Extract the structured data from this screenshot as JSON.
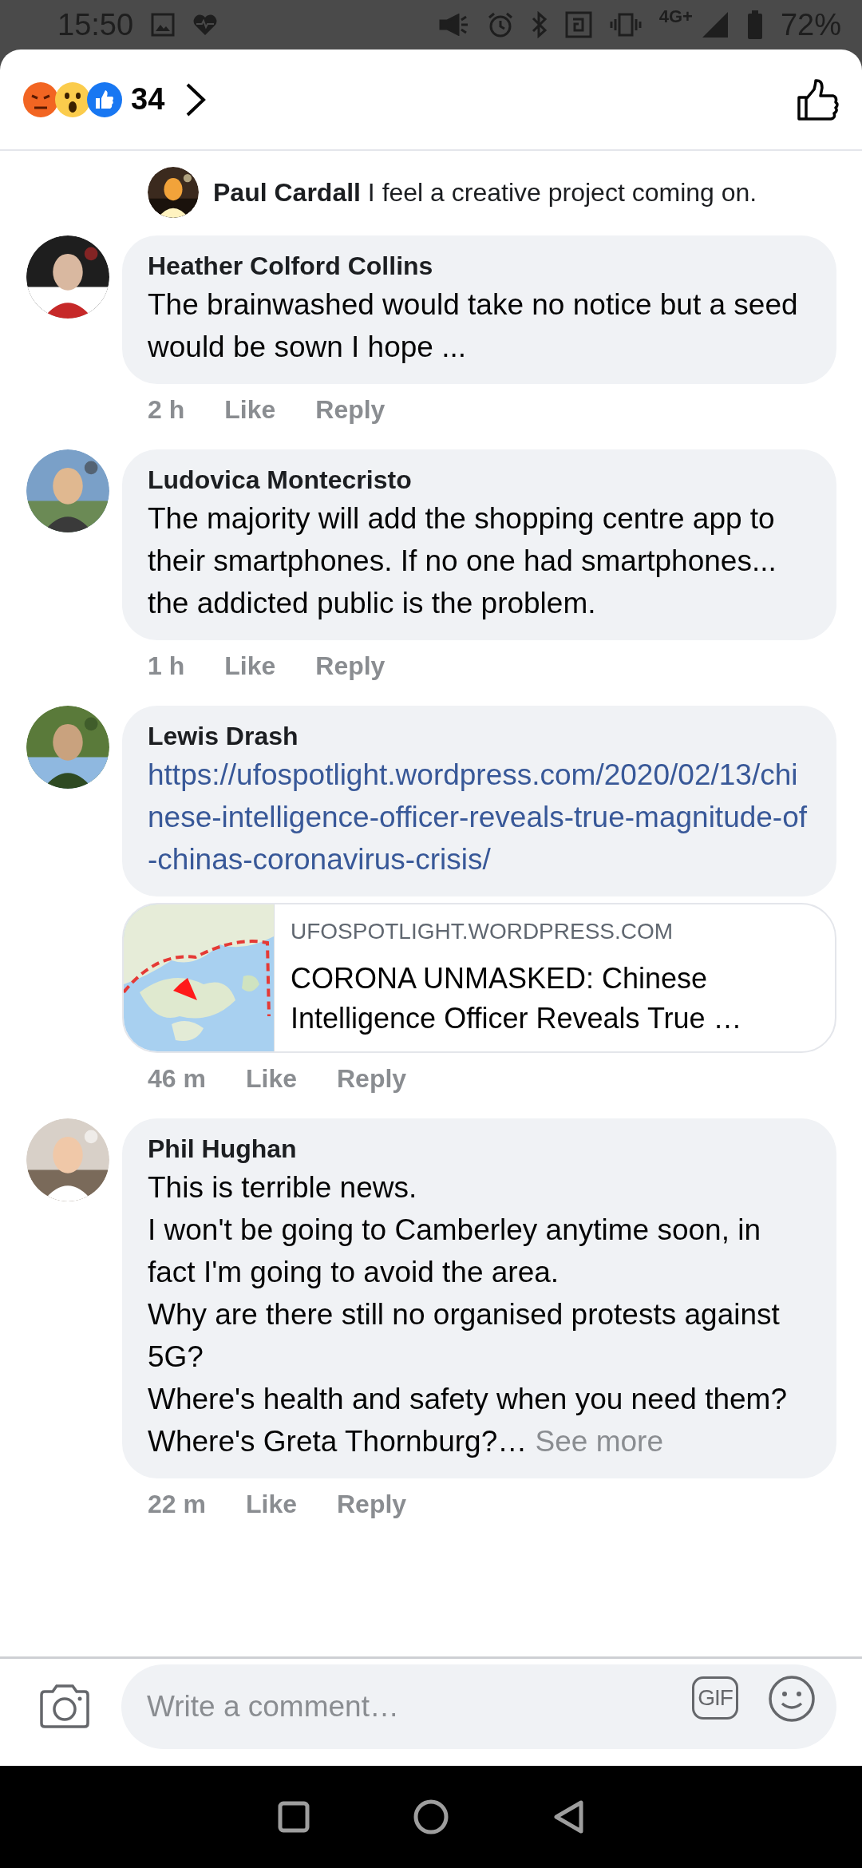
{
  "status_bar": {
    "time": "15:50",
    "network": "4G+",
    "battery": "72%"
  },
  "header": {
    "reaction_count": "34"
  },
  "reply_preview": {
    "author": "Paul Cardall",
    "text": "I feel a creative project coming on."
  },
  "comments": [
    {
      "kind": "text",
      "author": "Heather Colford Collins",
      "text": "The brainwashed would take no notice but a seed would be sown I hope ...",
      "time": "2 h",
      "actions": [
        "Like",
        "Reply"
      ]
    },
    {
      "kind": "text",
      "author": "Ludovica Montecristo",
      "text": "The majority will add the shopping centre app to their smartphones. If no one had smartphones... the addicted public is the problem.",
      "time": "1 h",
      "actions": [
        "Like",
        "Reply"
      ]
    },
    {
      "kind": "link",
      "author": "Lewis Drash",
      "text": "https://ufospotlight.wordpress.com/2020/02/13/chinese-intelligence-officer-reveals-true-magnitude-of-chinas-coronavirus-crisis/",
      "preview": {
        "domain": "UFOSPOTLIGHT.WORDPRESS.COM",
        "title": "CORONA UNMASKED: Chinese Intelligence Officer Reveals True …"
      },
      "time": "46 m",
      "actions": [
        "Like",
        "Reply"
      ]
    },
    {
      "kind": "text",
      "author": "Phil Hughan",
      "text": "This is terrible news.\nI won't be going to Camberley anytime soon, in fact I'm going to avoid the area.\nWhy are there still no organised protests against 5G?\nWhere's health and safety when you need them?\nWhere's Greta Thornburg?…",
      "see_more": "See more",
      "time": "22 m",
      "actions": [
        "Like",
        "Reply"
      ]
    }
  ],
  "composer": {
    "placeholder": "Write a comment…",
    "gif": "GIF"
  }
}
